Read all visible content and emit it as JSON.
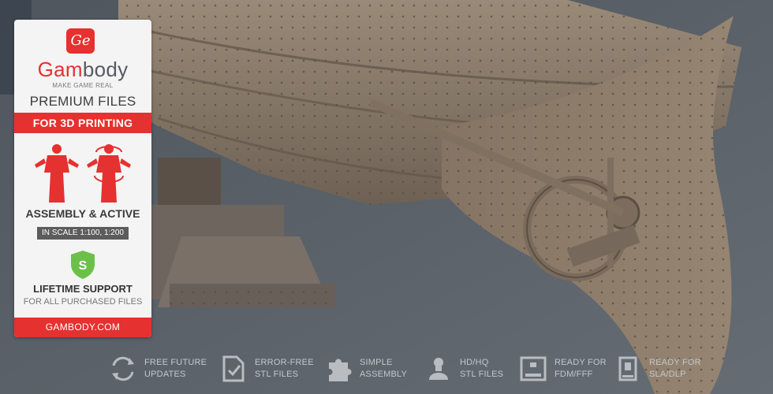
{
  "brand": {
    "badge": "Ge",
    "name_red": "Gam",
    "name_gray": "body",
    "tagline": "MAKE GAME REAL"
  },
  "card": {
    "premium": "PREMIUM FILES",
    "band": "FOR 3D PRINTING",
    "assembly": "ASSEMBLY & ACTIVE",
    "scale": "IN SCALE 1:100, 1:200",
    "shield_letter": "S",
    "lifetime": "LIFETIME SUPPORT",
    "purchased": "FOR ALL PURCHASED FILES",
    "site": "GAMBODY.COM"
  },
  "features": [
    {
      "icon": "update-arrows-icon",
      "line1": "FREE FUTURE",
      "line2": "UPDATES"
    },
    {
      "icon": "stl-file-check-icon",
      "line1": "ERROR-FREE",
      "line2": "STL FILES"
    },
    {
      "icon": "puzzle-piece-icon",
      "line1": "SIMPLE",
      "line2": "ASSEMBLY"
    },
    {
      "icon": "bust-figure-icon",
      "line1": "HD/HQ",
      "line2": "STL FILES"
    },
    {
      "icon": "fdm-printer-icon",
      "line1": "READY FOR",
      "line2": "FDM/FFF"
    },
    {
      "icon": "sla-printer-icon",
      "line1": "READY FOR",
      "line2": "SLA/DLP"
    }
  ],
  "colors": {
    "accent": "#e5312f",
    "background": "#5b636a",
    "hull": "#8a7866"
  }
}
